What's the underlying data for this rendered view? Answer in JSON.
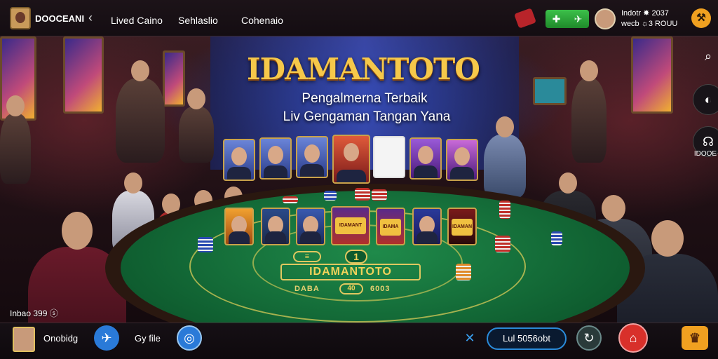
{
  "header": {
    "brand": "DOOCEANI",
    "back_icon": "chevron-left-icon",
    "nav": [
      "Lived Caino",
      "Sehlaslio",
      "Cohenaio"
    ],
    "red_badge_icon": "ticket-icon",
    "green_button_icons": [
      "gift-icon",
      "handshake-icon"
    ],
    "user_line1": "Indotr ✸ 2037",
    "user_line2": "wecb ☼3 ROUU",
    "settings_icon": "wrench-icon"
  },
  "hero": {
    "title": "IDAMANTOTO",
    "subtitle1": "Pengalmerna Terbaik",
    "subtitle2": "Liv Gengaman Tangan Yana"
  },
  "table": {
    "felt_title": "IDAMANTOTO",
    "felt_badge1": "≡",
    "felt_badge2": "1",
    "felt_sub_left": "DABA",
    "felt_sub_right": "6003",
    "felt_center_badge": "40",
    "top_cards": [
      "dealer-card-1",
      "dealer-card-2",
      "dealer-card-3",
      "dealer-card-4",
      "playing-cards",
      "dealer-card-6",
      "dealer-card-7"
    ],
    "felt_cards": [
      "game-card-1",
      "game-card-2",
      "game-card-3",
      "game-logo-1",
      "game-logo-2",
      "game-logo-3",
      "game-logo-4"
    ],
    "felt_logo_texts": [
      "IDAMANT",
      "IDAMA",
      "IDAMAN",
      "IDAMAN"
    ]
  },
  "side": {
    "search_icon": "search-icon",
    "chat_icon": "chat-icon",
    "support_icon": "headset-icon",
    "support_label": "IDOOE"
  },
  "footer": {
    "balance": "Inbao 399 ⓢ",
    "player_name": "Onobidg",
    "game_label": "Gy file",
    "live_label": "Lul 5056obt",
    "icons": [
      "avatar-icon",
      "sports-icon",
      "wheel-icon",
      "tools-icon",
      "refresh-icon",
      "home-icon",
      "trophy-icon"
    ]
  }
}
